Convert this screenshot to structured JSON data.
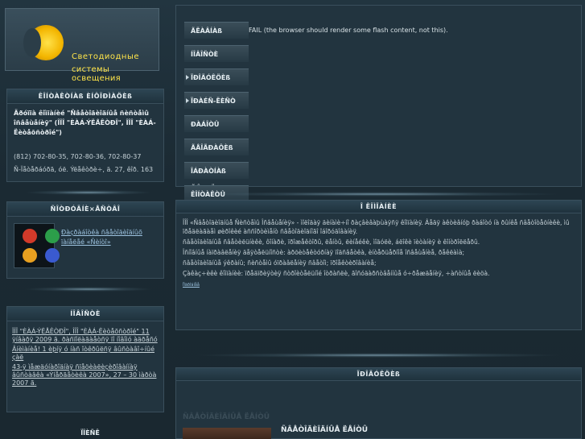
{
  "logo": {
    "line1": "Светодиодные",
    "line2": "системы освещения"
  },
  "contact": {
    "heading": "ÊÎÍÒÀÊÒÍÀß ÈÍÔÎÐÌÀÖÈß",
    "title": "Äðóïïà êîìïàíèé \"Ñâåòîäèîäíûå ñèñòåìû îñâåùåíèÿ\" (ÎÎÎ \"ÈÀÁ-ÝËÅÊÒÐÎ\", ÎÎÎ \"ÈÀÁ-Ëèòåõñòðîé\")",
    "phones": "(812) 702-80-35, 702-80-36, 702-80-37",
    "address": "Ñ-Ïåòåðáóðã, óë. Ýëåêòðè÷, ä. 27, êîð. 163"
  },
  "partners": {
    "heading": "ÑÎÒÐÓÄÍÈ×ÅÑÒÂÎ",
    "link": "Ðàçðàáîòêà ñâåòîäèîäíûõ ïàíåëåé «Ñèíòî»"
  },
  "news": {
    "heading": "ÍÎÂÎÑÒÈ",
    "items": [
      "ÎÎÎ \"ÈÀÁ-ÝËÅÊÒÐÎ\", ÎÎÎ \"ÈÀÁ-Ëèòåõñòðîé\" 11 ÿíâàðÿ 2009 ã. ðàñïîëàãàåòñÿ ïî íîâîìó àäðåñó",
      "Âíèìàíèå! 1 èþíÿ ó íàñ îòêðûëñÿ âûñòàâî÷íûé çàë",
      "43-ÿ ìåæäóíàðîäíàÿ ñïåöèàëèçèðîâàííàÿ âûñòàâêà «Ýíåðãåòèêà 2007», 27 – 30 ìàðòà 2007 ã."
    ]
  },
  "menu": {
    "items": [
      "ÃËÀÂÍÀß",
      "ÍÎÂÎÑÒÈ",
      "ÏÐÎÄÓÊÖÈß",
      "ÏÐÀÉÑ-ËÈÑÒ",
      "ÐÀÁÎÒÛ",
      "ÃÅÎÃÐÀÔÈß",
      "ÎÁÐÀÒÍÀß ÑÂßÇÜ",
      "ÊÎÍÒÀÊÒÛ"
    ]
  },
  "flash_message": "FAIL (the browser should render some flash content, not this).",
  "main": {
    "heading": "Î ÊÎÌÏÀÍÈÈ",
    "paragraphs": [
      "ÎÎÎ «Ñâåòîäèîäíûå Ñèñòåìû Îñâåùåíèÿ» - ìîëîäàÿ äèíàìè÷íî ðàçâèâàþùàÿñÿ êîìïàíèÿ. Âåäÿ àêòèâíóþ ðàáîòó íà ðûíêå ñâåòîòåõíèêè, ìû ïðåäëàãàåì øèðîêèé àññîðòèìåíò ñâåòîäèîäíîãî îáîðóäîâàíèÿ.",
      "ñâåòîäèîäíûå ñâåòèëüíèêè, ôîíàðè, ïðîæåêòîðû, ëåíòû, ëèíåéêè, ìîäóëè, áëîêè ïèòàíèÿ è êîíòðîëëåðû.",
      "Îñíîâíûå íàïðàâëåíèÿ äåÿòåëüíîñòè: àðõèòåêòóðíàÿ ïîäñâåòêà, èíòåðüåðíîå îñâåùåíèå, ðåêëàìà;",
      "ñâåòîäèîäíûå ýêðàíû; ñèñòåìû óïðàâëåíèÿ ñâåòîì; ïðîåêòèðîâàíèå;",
      "Çàêàç÷èêè êîìïàíèè: ïðåäïðèÿòèÿ ñòðîèòåëüíîé îòðàñëè, ãîñóäàðñòâåííûå ó÷ðåæäåíèÿ, ÷àñòíûå ëèöà."
    ],
    "small_link": "Ïîäðîáíåå"
  },
  "products": {
    "heading": "ÏÐÎÄÓÊÖÈß",
    "caption": "ÑÂÅÒÎÄÈÎÄÍÛÅ ËÅÍÒÛ",
    "title": "ÑÂÅÒÎÄÈÎÄÍÛÅ ËÅÍÒÛ"
  },
  "bottom_heading": "ÏÎÈÑÊ"
}
